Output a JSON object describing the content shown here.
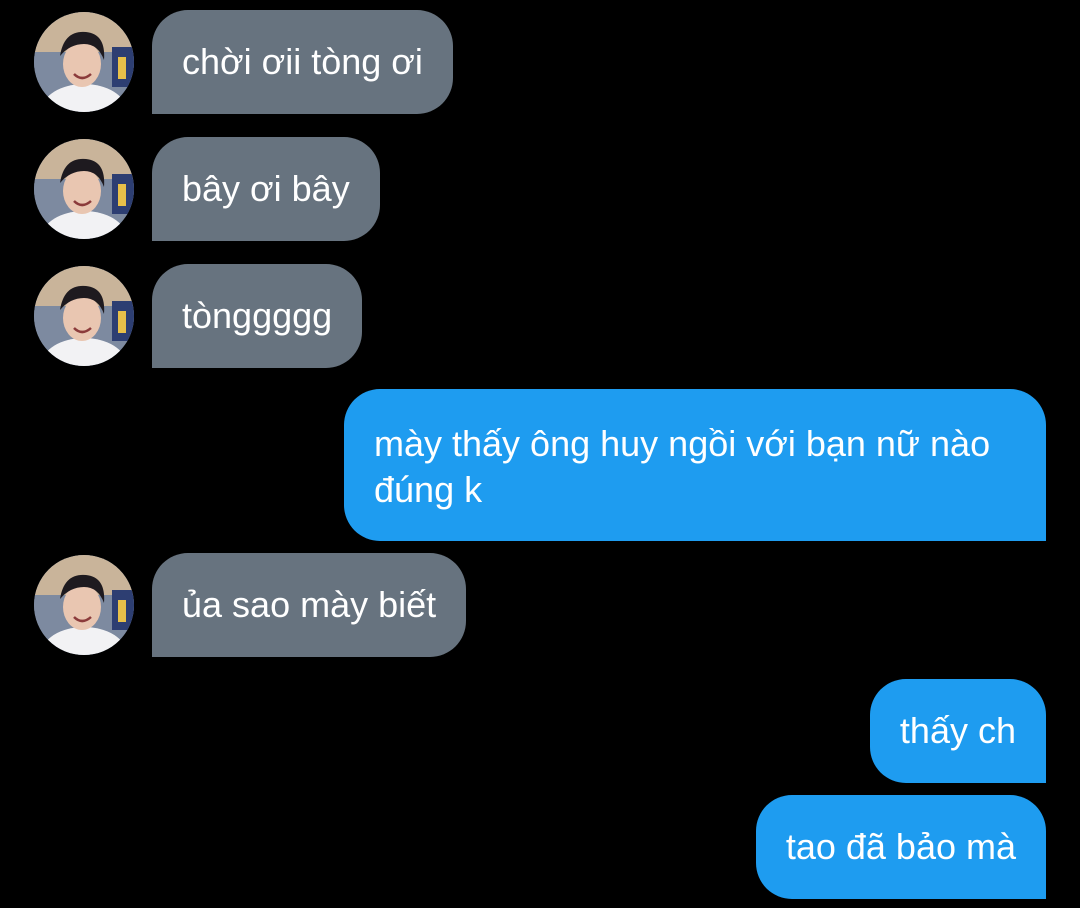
{
  "conversation": {
    "messages": [
      {
        "side": "incoming",
        "text": "chời ơii tòng ơi"
      },
      {
        "side": "incoming",
        "text": "bây ơi bây"
      },
      {
        "side": "incoming",
        "text": "tònggggg"
      },
      {
        "side": "outgoing",
        "text": "mày thấy ông huy ngồi với bạn nữ nào đúng k"
      },
      {
        "side": "incoming",
        "text": "ủa sao mày biết"
      },
      {
        "side": "outgoing",
        "text": "thấy ch"
      },
      {
        "side": "outgoing",
        "text": "tao đã bảo mà"
      }
    ]
  },
  "colors": {
    "background": "#000000",
    "incoming_bubble": "#67737f",
    "outgoing_bubble": "#1e9cf0",
    "text": "#ffffff"
  },
  "icons": {
    "avatar": "contact-avatar-photo"
  }
}
